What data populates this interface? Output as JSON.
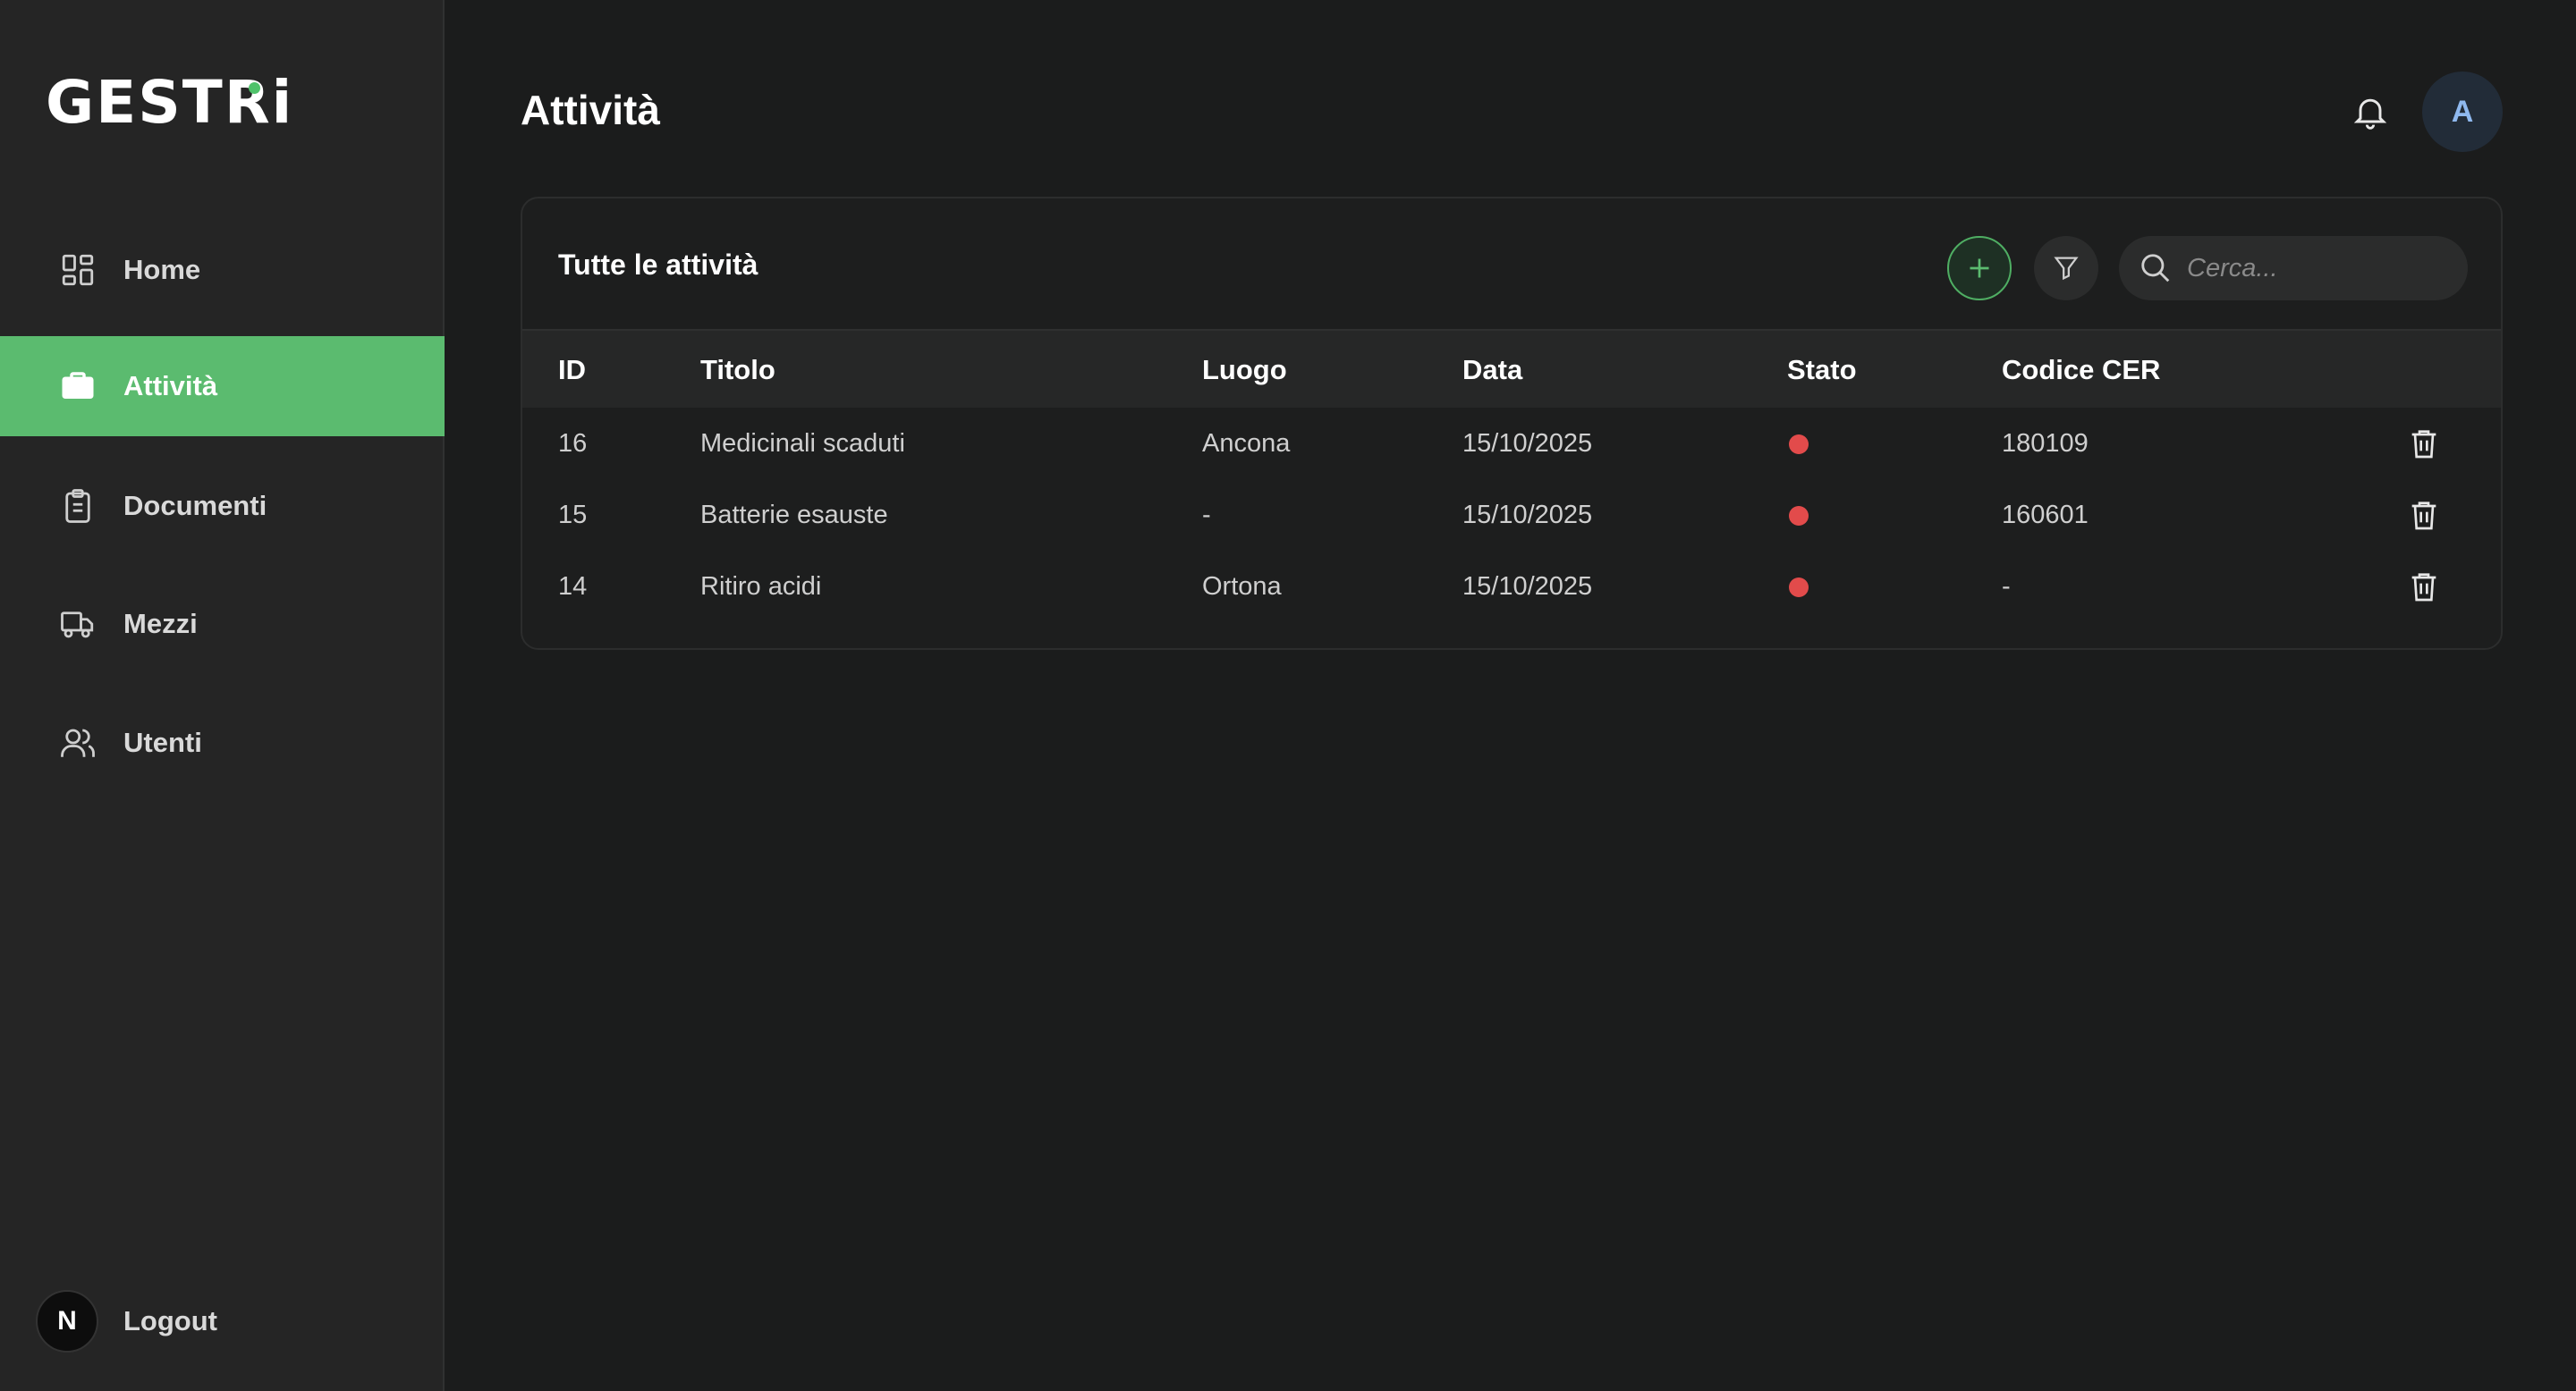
{
  "app": {
    "logo": "GESTRi",
    "accent_color": "#5bbb6f",
    "danger_color": "#e24b4b"
  },
  "sidebar": {
    "items": [
      {
        "label": "Home",
        "icon": "grid-icon",
        "active": false
      },
      {
        "label": "Attività",
        "icon": "briefcase-icon",
        "active": true
      },
      {
        "label": "Documenti",
        "icon": "clipboard-icon",
        "active": false
      },
      {
        "label": "Mezzi",
        "icon": "truck-icon",
        "active": false
      },
      {
        "label": "Utenti",
        "icon": "users-icon",
        "active": false
      }
    ],
    "logout": {
      "label": "Logout",
      "avatar_letter": "N"
    }
  },
  "header": {
    "title": "Attività",
    "user_initial": "A"
  },
  "card": {
    "title": "Tutte le attività",
    "search_placeholder": "Cerca...",
    "columns": [
      "ID",
      "Titolo",
      "Luogo",
      "Data",
      "Stato",
      "Codice CER"
    ],
    "rows": [
      {
        "id": "16",
        "titolo": "Medicinali scaduti",
        "luogo": "Ancona",
        "data": "15/10/2025",
        "stato": "red",
        "cer": "180109"
      },
      {
        "id": "15",
        "titolo": "Batterie esauste",
        "luogo": "-",
        "data": "15/10/2025",
        "stato": "red",
        "cer": "160601"
      },
      {
        "id": "14",
        "titolo": "Ritiro acidi",
        "luogo": "Ortona",
        "data": "15/10/2025",
        "stato": "red",
        "cer": "-"
      }
    ]
  }
}
